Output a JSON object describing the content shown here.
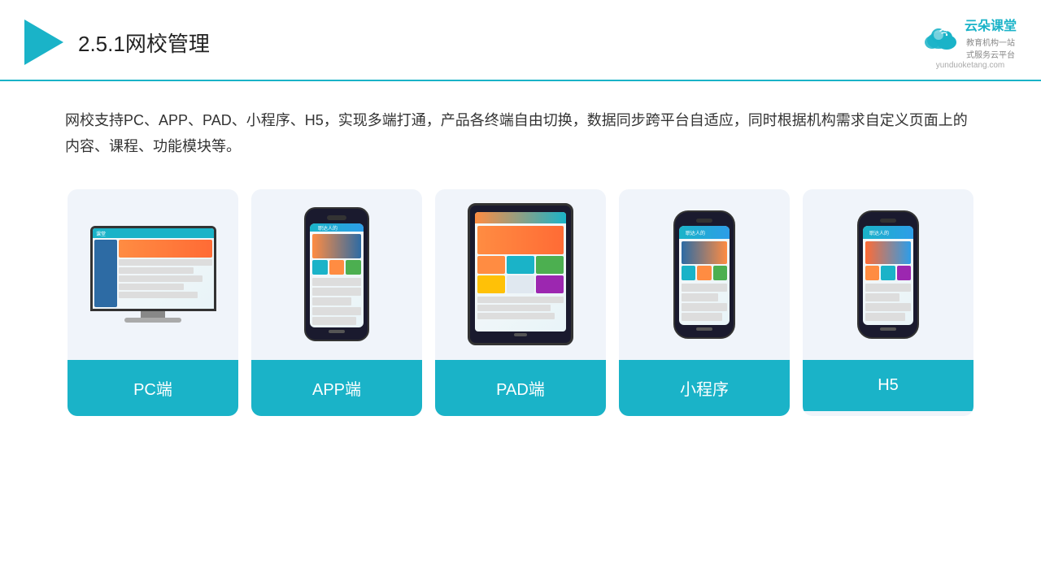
{
  "header": {
    "title_prefix": "2.5.1",
    "title_main": "网校管理",
    "logo_name": "云朵课堂",
    "logo_url": "yunduoketang.com",
    "logo_tagline": "教育机构一站\n式服务云平台"
  },
  "description": {
    "text": "网校支持PC、APP、PAD、小程序、H5，实现多端打通，产品各终端自由切换，数据同步跨平台自适应，同时根据机构需求自定义页面上的内容、课程、功能模块等。"
  },
  "cards": [
    {
      "id": "pc",
      "label": "PC端"
    },
    {
      "id": "app",
      "label": "APP端"
    },
    {
      "id": "pad",
      "label": "PAD端"
    },
    {
      "id": "miniprogram",
      "label": "小程序"
    },
    {
      "id": "h5",
      "label": "H5"
    }
  ],
  "colors": {
    "accent": "#1ab3c8",
    "header_border": "#1ab3c8",
    "card_bg": "#f0f4fa",
    "card_label_bg": "#1ab3c8",
    "card_label_text": "#ffffff"
  }
}
